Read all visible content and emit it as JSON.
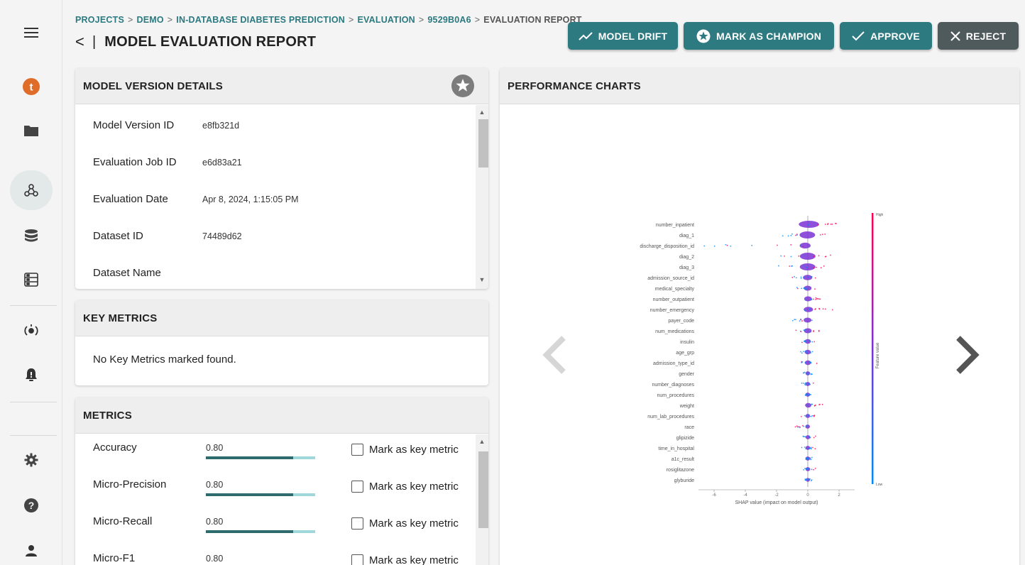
{
  "breadcrumb": {
    "items": [
      "PROJECTS",
      "DEMO",
      "IN-DATABASE DIABETES PREDICTION",
      "EVALUATION",
      "9529B0A6"
    ],
    "current": "EVALUATION REPORT",
    "separator": ">"
  },
  "header": {
    "back_glyph": "<",
    "title_separator": "|",
    "title": "MODEL EVALUATION REPORT"
  },
  "actions": {
    "model_drift": "MODEL DRIFT",
    "mark_champion": "MARK AS CHAMPION",
    "approve": "APPROVE",
    "reject": "REJECT"
  },
  "sidebar": {
    "items": [
      {
        "icon": "menu-icon"
      },
      {
        "icon": "brand-logo-icon"
      },
      {
        "icon": "folder-icon"
      },
      {
        "icon": "model-network-icon",
        "active": true
      },
      {
        "icon": "database-icon"
      },
      {
        "icon": "server-icon"
      },
      {
        "icon": "deploy-cycle-icon"
      },
      {
        "icon": "alert-bell-icon"
      },
      {
        "icon": "gear-icon"
      },
      {
        "icon": "help-icon"
      },
      {
        "icon": "user-icon"
      }
    ]
  },
  "model_details": {
    "title": "MODEL VERSION DETAILS",
    "rows": [
      {
        "label": "Model Version ID",
        "value": "e8fb321d"
      },
      {
        "label": "Evaluation Job ID",
        "value": "e6d83a21"
      },
      {
        "label": "Evaluation Date",
        "value": "Apr 8, 2024, 1:15:05 PM"
      },
      {
        "label": "Dataset ID",
        "value": "74489d62"
      },
      {
        "label": "Dataset Name",
        "value": ""
      }
    ]
  },
  "key_metrics": {
    "title": "KEY METRICS",
    "empty_text": "No Key Metrics marked found."
  },
  "metrics": {
    "title": "METRICS",
    "checkbox_label": "Mark as key metric",
    "rows": [
      {
        "label": "Accuracy",
        "value": "0.80",
        "fraction": 0.8
      },
      {
        "label": "Micro-Precision",
        "value": "0.80",
        "fraction": 0.8
      },
      {
        "label": "Micro-Recall",
        "value": "0.80",
        "fraction": 0.8
      },
      {
        "label": "Micro-F1",
        "value": "0.80",
        "fraction": 0.8
      }
    ]
  },
  "performance_charts": {
    "title": "PERFORMANCE CHARTS"
  },
  "chart_data": {
    "type": "scatter",
    "title": "",
    "xlabel": "SHAP value (impact on model output)",
    "ylabel": "",
    "colorbar_label": "Feature value",
    "colorbar_high": "High",
    "colorbar_low": "Low",
    "xlim": [
      -7,
      3
    ],
    "xticks": [
      "-6",
      "-4",
      "-2",
      "0",
      "2"
    ],
    "features": [
      {
        "name": "number_inpatient",
        "min": -0.2,
        "max": 2.8,
        "spread": 1.3
      },
      {
        "name": "diag_1",
        "min": -2.2,
        "max": 1.2,
        "spread": 1.0
      },
      {
        "name": "discharge_disposition_id",
        "min": -7.0,
        "max": 0.8,
        "spread": 0.7
      },
      {
        "name": "diag_2",
        "min": -1.8,
        "max": 1.6,
        "spread": 1.0
      },
      {
        "name": "diag_3",
        "min": -2.0,
        "max": 1.6,
        "spread": 1.0
      },
      {
        "name": "admission_source_id",
        "min": -1.0,
        "max": 0.6,
        "spread": 0.6
      },
      {
        "name": "medical_specialty",
        "min": -0.8,
        "max": 0.5,
        "spread": 0.5
      },
      {
        "name": "number_outpatient",
        "min": -0.2,
        "max": 0.8,
        "spread": 0.5
      },
      {
        "name": "number_emergency",
        "min": -0.2,
        "max": 1.6,
        "spread": 0.6
      },
      {
        "name": "payer_code",
        "min": -1.0,
        "max": 0.4,
        "spread": 0.5
      },
      {
        "name": "num_medications",
        "min": -0.8,
        "max": 0.8,
        "spread": 0.5
      },
      {
        "name": "insulin",
        "min": -0.5,
        "max": 0.5,
        "spread": 0.4
      },
      {
        "name": "age_grp",
        "min": -0.5,
        "max": 0.4,
        "spread": 0.4
      },
      {
        "name": "admission_type_id",
        "min": -0.4,
        "max": 0.6,
        "spread": 0.4
      },
      {
        "name": "gender",
        "min": -0.3,
        "max": 0.3,
        "spread": 0.3
      },
      {
        "name": "number_diagnoses",
        "min": -0.4,
        "max": 0.4,
        "spread": 0.3
      },
      {
        "name": "num_procedures",
        "min": -0.3,
        "max": 0.3,
        "spread": 0.3
      },
      {
        "name": "weight",
        "min": -0.1,
        "max": 1.1,
        "spread": 0.4
      },
      {
        "name": "num_lab_procedures",
        "min": -0.5,
        "max": 0.5,
        "spread": 0.3
      },
      {
        "name": "race",
        "min": -0.8,
        "max": 0.4,
        "spread": 0.3
      },
      {
        "name": "glipizide",
        "min": -0.3,
        "max": 0.5,
        "spread": 0.3
      },
      {
        "name": "time_in_hospital",
        "min": -0.4,
        "max": 0.5,
        "spread": 0.3
      },
      {
        "name": "a1c_result",
        "min": -0.3,
        "max": 0.3,
        "spread": 0.3
      },
      {
        "name": "rosiglitazone",
        "min": -0.3,
        "max": 0.5,
        "spread": 0.3
      },
      {
        "name": "glyburide",
        "min": -0.2,
        "max": 0.3,
        "spread": 0.2
      }
    ],
    "colors": {
      "high": "#ff0052",
      "low": "#008bfb",
      "mid": "#7b33d6"
    }
  }
}
